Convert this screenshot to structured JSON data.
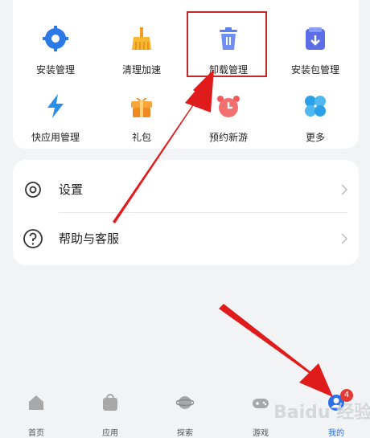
{
  "tools": [
    {
      "label": "安装管理",
      "icon": "gear-icon",
      "color": "#2a79e6"
    },
    {
      "label": "清理加速",
      "icon": "broom-icon",
      "color": "#f0a020"
    },
    {
      "label": "卸载管理",
      "icon": "trash-icon",
      "color": "#5b7ff0"
    },
    {
      "label": "安装包管理",
      "icon": "package-icon",
      "color": "#5b6ee8"
    },
    {
      "label": "快应用管理",
      "icon": "lightning-icon",
      "color": "#2a8fe8"
    },
    {
      "label": "礼包",
      "icon": "gift-icon",
      "color": "#f08a20"
    },
    {
      "label": "预约新游",
      "icon": "alarm-clock-icon",
      "color": "#f25b5b"
    },
    {
      "label": "更多",
      "icon": "clover-icon",
      "color": "#2aa0e8"
    }
  ],
  "settings_rows": [
    {
      "label": "设置",
      "icon": "gear-outline-icon"
    },
    {
      "label": "帮助与客服",
      "icon": "question-circle-icon"
    }
  ],
  "nav": [
    {
      "label": "首页",
      "icon": "home-icon"
    },
    {
      "label": "应用",
      "icon": "shopping-bag-icon"
    },
    {
      "label": "探索",
      "icon": "planet-icon"
    },
    {
      "label": "游戏",
      "icon": "gamepad-icon"
    },
    {
      "label": "我的",
      "icon": "avatar-icon",
      "active": true,
      "badge": "4"
    }
  ],
  "watermark": "Baidu 经验",
  "colors": {
    "accent": "#2a6fe8",
    "annotation_red": "#e01b1b",
    "badge": "#e53935"
  }
}
